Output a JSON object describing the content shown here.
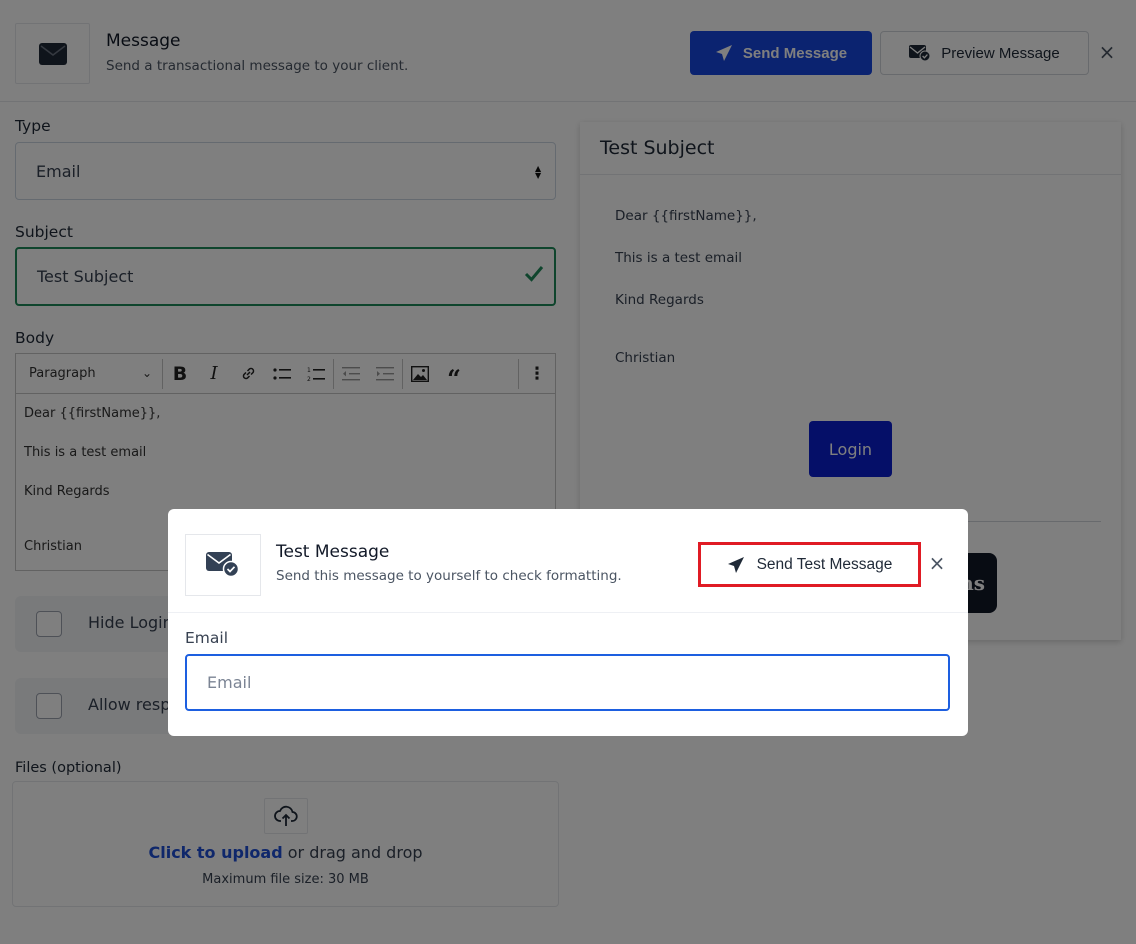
{
  "header": {
    "title": "Message",
    "subtitle": "Send a transactional message to your client.",
    "send_label": "Send Message",
    "preview_label": "Preview Message",
    "close_glyph": "×",
    "icon": "envelope-icon"
  },
  "form": {
    "type_label": "Type",
    "type_value": "Email",
    "subject_label": "Subject",
    "subject_value": "Test Subject",
    "body_label": "Body",
    "toolbar": {
      "block_format": "Paragraph",
      "buttons": [
        "bold",
        "italic",
        "link",
        "bullet-list",
        "numbered-list",
        "outdent",
        "indent",
        "image",
        "blockquote",
        "more"
      ]
    },
    "body_lines": [
      "Dear {{firstName}},",
      "This is a test email",
      "Kind Regards",
      "",
      "Christian"
    ],
    "checkboxes": [
      {
        "label": "Hide Login",
        "checked": false
      },
      {
        "label": "Allow resp",
        "checked": false
      }
    ],
    "files_label": "Files (optional)",
    "upload_link": "Click to upload",
    "upload_rest": " or drag and drop",
    "upload_limit": "Maximum file size: 30 MB"
  },
  "preview": {
    "subject": "Test Subject",
    "lines": [
      "Dear {{firstName}},",
      "This is a test email",
      "Kind Regards",
      "",
      "Christian"
    ],
    "login_label": "Login",
    "dark_button_partial": "ns"
  },
  "modal": {
    "title": "Test Message",
    "subtitle": "Send this message to yourself to check formatting.",
    "send_test_label": "Send Test Message",
    "close_glyph": "×",
    "email_label": "Email",
    "email_value": "",
    "email_placeholder": "Email",
    "icon": "envelope-check-icon"
  },
  "colors": {
    "primary": "#1746e0",
    "success": "#1f8a5a",
    "highlight": "#e01b24",
    "focus": "#1d5fe0",
    "login_button": "#0a1fd0",
    "overlay": "rgba(0,0,0,0.5)"
  }
}
